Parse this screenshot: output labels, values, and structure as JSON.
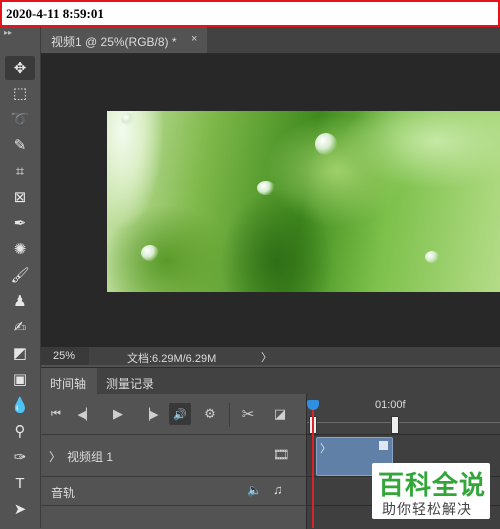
{
  "timestamp": "2020-4-11 8:59:01",
  "document_tab": {
    "title": "视频1 @ 25%(RGB/8) *",
    "close": "×"
  },
  "status": {
    "zoom": "25%",
    "doc_size": "文档:6.29M/6.29M",
    "arrow": "〉"
  },
  "panel": {
    "tabs": [
      "时间轴",
      "测量记录"
    ],
    "active_tab": "时间轴",
    "ruler_label": "01:00f",
    "tracks": [
      {
        "label": "视频组 1",
        "expander": "〉"
      },
      {
        "label": "音轨"
      }
    ]
  },
  "watermark": {
    "title": "百科全说",
    "subtitle": "助你轻松解决"
  },
  "colors": {
    "accent_red": "#e4151a",
    "clip_blue": "#6080a8",
    "playhead": "#d8232a",
    "watermark_green": "#33a63a"
  }
}
